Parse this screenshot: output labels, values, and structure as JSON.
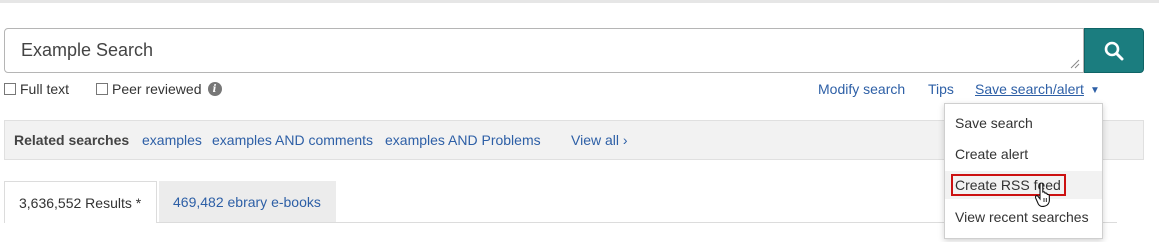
{
  "search": {
    "query": "Example Search",
    "button_icon": "search-icon"
  },
  "options": {
    "full_text": "Full text",
    "peer_reviewed": "Peer reviewed",
    "info_glyph": "i"
  },
  "actions": {
    "modify_search": "Modify search",
    "tips": "Tips",
    "save_search_alert": "Save search/alert",
    "caret": "▼"
  },
  "related": {
    "label": "Related searches",
    "links": [
      "examples",
      "examples AND comments",
      "examples AND Problems"
    ],
    "view_all": "View all ›"
  },
  "tabs": [
    {
      "label": "3,636,552 Results *",
      "active": true
    },
    {
      "label": "469,482 ebrary e-books",
      "active": false
    }
  ],
  "dropdown": {
    "items": [
      "Save search",
      "Create alert",
      "Create RSS feed",
      "View recent searches"
    ],
    "highlighted_index": 2
  },
  "colors": {
    "accent": "#1b7d7f",
    "link": "#2d5fa6",
    "highlight_border": "#cc1111"
  }
}
